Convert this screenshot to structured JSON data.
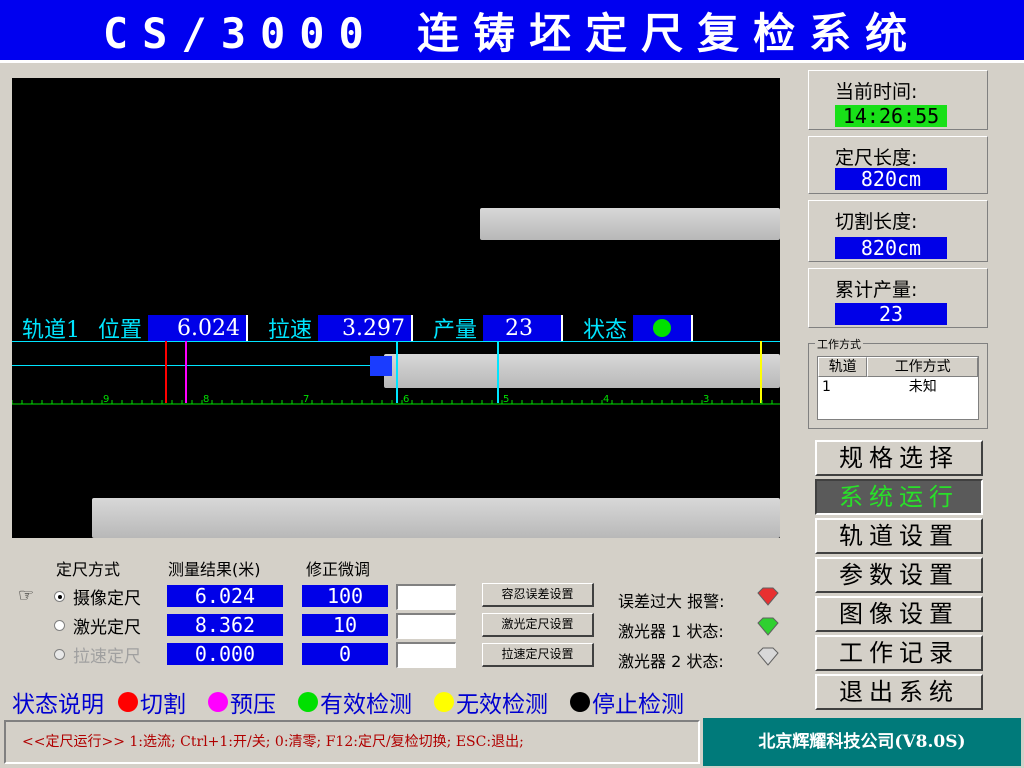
{
  "title": "CS/3000 连铸坯定尺复检系统",
  "overlay": {
    "track_label": "轨道1",
    "position_label": "位置",
    "position_value": "6.024",
    "speed_label": "拉速",
    "speed_value": "3.297",
    "output_label": "产量",
    "output_value": "23",
    "status_label": "状态",
    "status_color": "#00e000",
    "ruler_ticks": [
      "9",
      "8",
      "7",
      "6",
      "5",
      "4",
      "3"
    ]
  },
  "info": {
    "time_label": "当前时间:",
    "time_value": "14:26:55",
    "cut_len_label": "定尺长度:",
    "cut_len_value": "820cm",
    "cutting_len_label": "切割长度:",
    "cutting_len_value": "820cm",
    "total_label": "累计产量:",
    "total_value": "23"
  },
  "mode_group": {
    "title": "工作方式",
    "headers": [
      "轨道",
      "工作方式"
    ],
    "rows": [
      [
        "1",
        "未知"
      ]
    ]
  },
  "menu": [
    "规格选择",
    "系统运行",
    "轨道设置",
    "参数设置",
    "图像设置",
    "工作记录",
    "退出系统"
  ],
  "controls": {
    "headers": [
      "定尺方式",
      "测量结果(米)",
      "修正微调"
    ],
    "rows": [
      {
        "label": "摄像定尺",
        "result": "6.024",
        "adjust": "100",
        "selected": true,
        "enabled": true
      },
      {
        "label": "激光定尺",
        "result": "8.362",
        "adjust": "10",
        "selected": false,
        "enabled": true
      },
      {
        "label": "拉速定尺",
        "result": "0.000",
        "adjust": "0",
        "selected": false,
        "enabled": false
      }
    ],
    "buttons": [
      "容忍误差设置",
      "激光定尺设置",
      "拉速定尺设置"
    ],
    "alarms": [
      "误差过大 报警:",
      "激光器 1 状态:",
      "激光器 2 状态:"
    ],
    "alarm_colors": [
      "#e83030",
      "#30d030",
      "#d8d8d8"
    ]
  },
  "legend": {
    "title": "状态说明",
    "items": [
      {
        "label": "切割",
        "color": "#ff0000"
      },
      {
        "label": "预压",
        "color": "#ff00ff"
      },
      {
        "label": "有效检测",
        "color": "#00e000"
      },
      {
        "label": "无效检测",
        "color": "#ffff00"
      },
      {
        "label": "停止检测",
        "color": "#000000"
      }
    ]
  },
  "status_bar": "<<定尺运行>> 1:选流; Ctrl+1:开/关; 0:清零; F12:定尺/复检切换; ESC:退出;",
  "company": "北京辉耀科技公司(V8.0S)"
}
